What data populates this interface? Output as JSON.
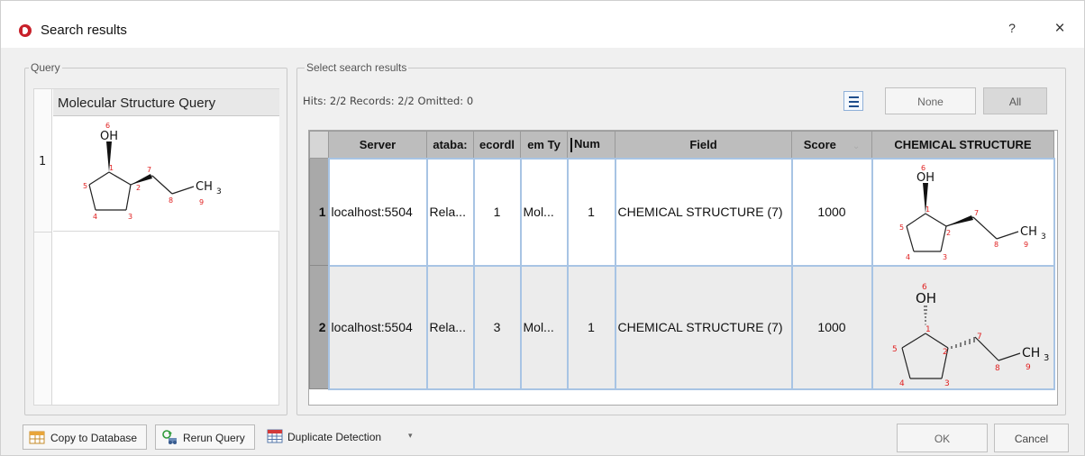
{
  "window": {
    "title": "Search results",
    "help": "?",
    "close": "×"
  },
  "query": {
    "group_label": "Query",
    "column_header": "Molecular Structure Query",
    "rows": [
      {
        "num": "1"
      }
    ]
  },
  "results": {
    "group_label": "Select search results",
    "hits_text": "Hits: 2/2 Records: 2/2 Omitted: 0",
    "none_label": "None",
    "all_label": "All",
    "columns": [
      "Server",
      "ataba:",
      "ecordl",
      "em Ty",
      "Num",
      "Field",
      "Score",
      "CHEMICAL STRUCTURE"
    ],
    "rows": [
      {
        "num": "1",
        "server": "localhost:5504",
        "database": "Rela...",
        "record": "1",
        "type": "Mol...",
        "num_col": "1",
        "field": "CHEMICAL STRUCTURE (7)",
        "score": "1000"
      },
      {
        "num": "2",
        "server": "localhost:5504",
        "database": "Rela...",
        "record": "3",
        "type": "Mol...",
        "num_col": "1",
        "field": "CHEMICAL STRUCTURE (7)",
        "score": "1000"
      }
    ]
  },
  "molecule": {
    "oh": "OH",
    "ch": "CH",
    "sub3": "3",
    "atoms": [
      "6",
      "1",
      "2",
      "3",
      "4",
      "5",
      "7",
      "8",
      "9"
    ]
  },
  "footer": {
    "copy_label": "Copy to Database",
    "rerun_label": "Rerun Query",
    "dup_label": "Duplicate Detection",
    "ok_label": "OK",
    "cancel_label": "Cancel"
  },
  "colors": {
    "atom_number": "#e02020",
    "accent": "#1f4e8c",
    "row_border": "#a8c4e4"
  }
}
